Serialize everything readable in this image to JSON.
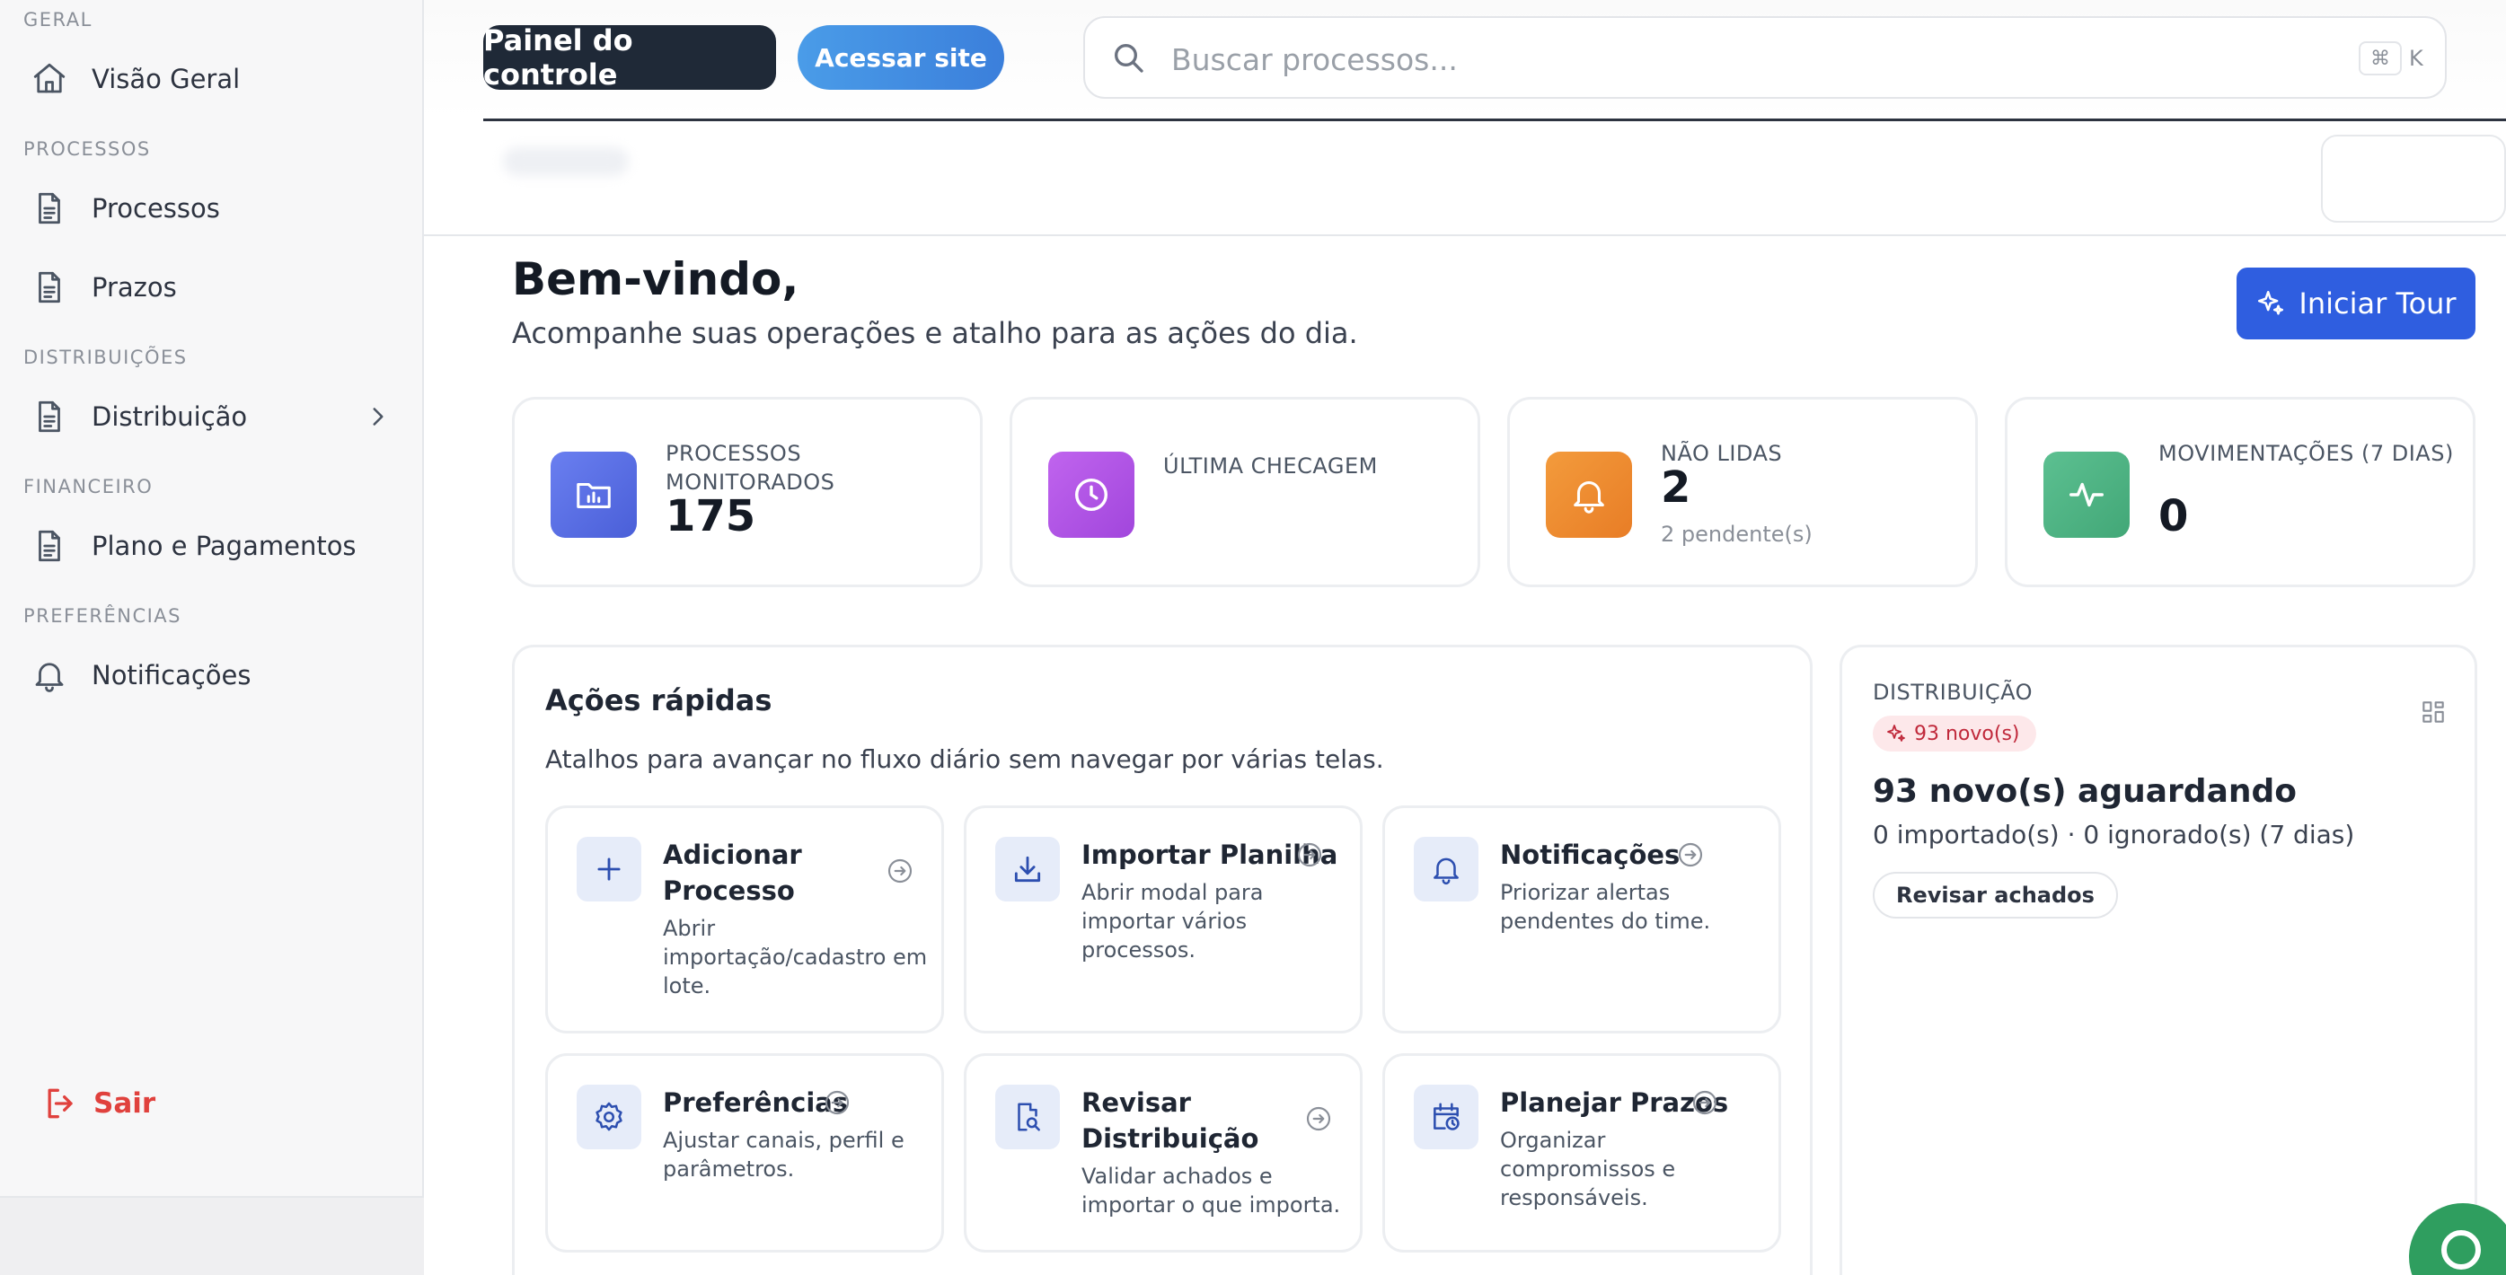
{
  "sidebar": {
    "sections": [
      {
        "title": "GERAL",
        "items": [
          {
            "label": "Visão Geral",
            "icon": "home-icon"
          }
        ]
      },
      {
        "title": "PROCESSOS",
        "items": [
          {
            "label": "Processos",
            "icon": "document-icon"
          },
          {
            "label": "Prazos",
            "icon": "document-icon"
          }
        ]
      },
      {
        "title": "DISTRIBUIÇÕES",
        "items": [
          {
            "label": "Distribuição",
            "icon": "document-icon",
            "has_chevron": true
          }
        ]
      },
      {
        "title": "FINANCEIRO",
        "items": [
          {
            "label": "Plano e Pagamentos",
            "icon": "document-icon"
          }
        ]
      },
      {
        "title": "PREFERÊNCIAS",
        "items": [
          {
            "label": "Notificações",
            "icon": "bell-icon"
          }
        ]
      }
    ],
    "logout_label": "Sair"
  },
  "topbar": {
    "dashboard_button": "Painel do controle",
    "site_button": "Acessar site",
    "search_placeholder": "Buscar processos...",
    "shortcut_symbol": "⌘",
    "shortcut_key": "K"
  },
  "welcome": {
    "title": "Bem-vindo,",
    "subtitle": "Acompanhe suas operações e atalho para as ações do dia.",
    "tour_button": "Iniciar Tour"
  },
  "stats": [
    {
      "label": "PROCESSOS MONITORADOS",
      "value": "175",
      "sub": "",
      "icon": "folder-chart-icon",
      "color": "#5a6fe0"
    },
    {
      "label": "ÚLTIMA CHECAGEM",
      "value": "",
      "sub": "",
      "icon": "clock-icon",
      "color": "#b054e0"
    },
    {
      "label": "NÃO LIDAS",
      "value": "2",
      "sub": "2 pendente(s)",
      "icon": "bell-icon",
      "color": "#ee8a30"
    },
    {
      "label": "MOVIMENTAÇÕES (7 DIAS)",
      "value": "0",
      "sub": "",
      "icon": "activity-icon",
      "color": "#4db184"
    }
  ],
  "quick_actions": {
    "title": "Ações rápidas",
    "subtitle": "Atalhos para avançar no fluxo diário sem navegar por várias telas.",
    "items": [
      {
        "title": "Adicionar Processo",
        "desc": "Abrir importação/cadastro em lote.",
        "icon": "plus-icon"
      },
      {
        "title": "Importar Planilha",
        "desc": "Abrir modal para importar vários processos.",
        "icon": "download-icon"
      },
      {
        "title": "Notificações",
        "desc": "Priorizar alertas pendentes do time.",
        "icon": "bell-icon"
      },
      {
        "title": "Preferências",
        "desc": "Ajustar canais, perfil e parâmetros.",
        "icon": "gear-icon"
      },
      {
        "title": "Revisar Distribuição",
        "desc": "Validar achados e importar o que importa.",
        "icon": "file-search-icon"
      },
      {
        "title": "Planejar Prazos",
        "desc": "Organizar compromissos e responsáveis.",
        "icon": "calendar-clock-icon"
      }
    ]
  },
  "distribution": {
    "label": "DISTRIBUIÇÃO",
    "badge": "93 novo(s)",
    "headline": "93 novo(s) aguardando",
    "stats": "0 importado(s) · 0 ignorado(s) (7 dias)",
    "review_button": "Revisar achados"
  },
  "colors": {
    "accent_blue": "#2f5ee0",
    "danger": "#e0413d",
    "chat_green": "#2f9e5f"
  }
}
